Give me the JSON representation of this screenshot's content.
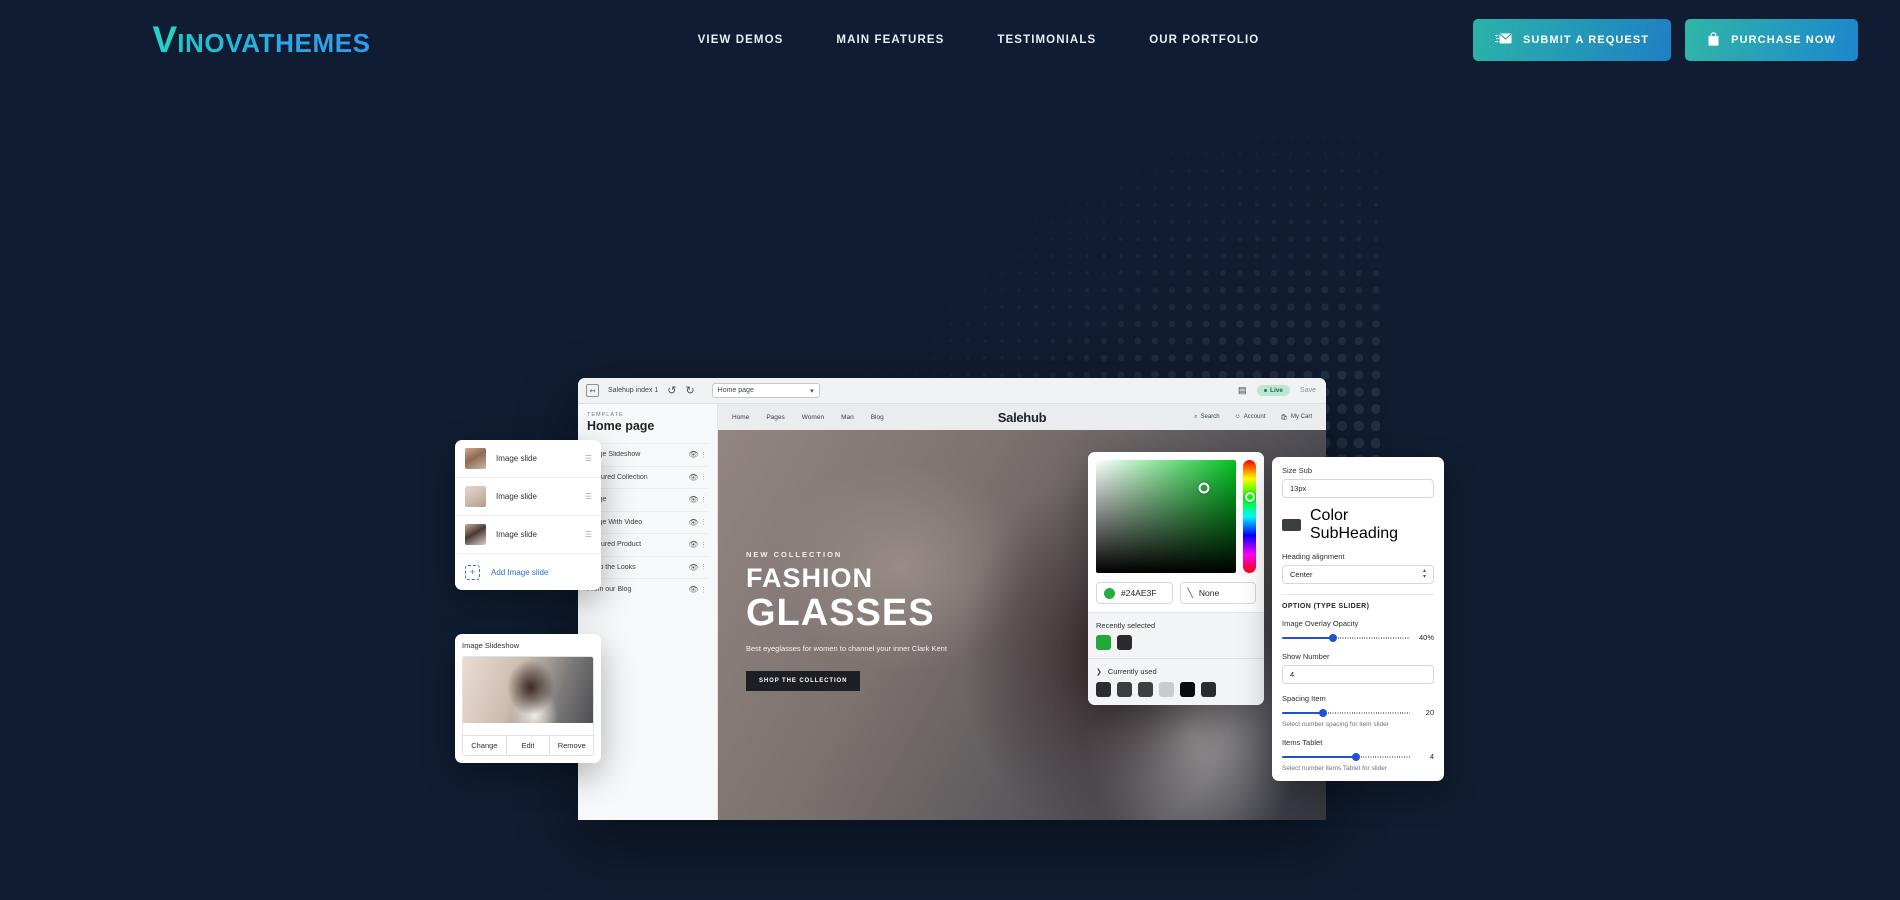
{
  "theme": {
    "page_bg": "#101c31",
    "accent_teal": "#22d3c5",
    "accent_blue": "#2f9bf0",
    "picker_green": "#24AE3F",
    "slider_blue": "#1f52d1"
  },
  "topnav": {
    "logo": {
      "first_letter": "V",
      "rest": "INOVATHEMES"
    },
    "links": [
      {
        "label": "VIEW DEMOS",
        "name": "nav-view-demos"
      },
      {
        "label": "MAIN FEATURES",
        "name": "nav-main-features"
      },
      {
        "label": "TESTIMONIALS",
        "name": "nav-testimonials"
      },
      {
        "label": "OUR PORTFOLIO",
        "name": "nav-our-portfolio"
      }
    ],
    "buttons": {
      "submit": {
        "label": "SUBMIT A REQUEST",
        "icon": "envelope-icon"
      },
      "purchase": {
        "label": "PURCHASE NOW",
        "icon": "shopping-bag-icon"
      }
    }
  },
  "editor": {
    "toolbar": {
      "exit_icon": "exit-icon",
      "title": "Salehup index 1",
      "undo_icon": "undo-icon",
      "redo_icon": "redo-icon",
      "page_select": "Home page",
      "device_icon": "desktop-icon",
      "live_badge": "Live",
      "save_label": "Save"
    },
    "sidebar": {
      "template_label": "TEMPLATE",
      "template_name": "Home page",
      "layers": [
        {
          "label": "Image Slideshow"
        },
        {
          "label": "Featured Collection"
        },
        {
          "label": "Image"
        },
        {
          "label": "Image With Video"
        },
        {
          "label": "Featured Product"
        },
        {
          "label": "Shop the Looks"
        },
        {
          "label": "From our Blog"
        }
      ]
    },
    "store": {
      "logo": "Salehub",
      "nav": [
        "Home",
        "Pages",
        "Women",
        "Man",
        "Blog"
      ],
      "actions": [
        {
          "label": "Search",
          "icon": "search-icon"
        },
        {
          "label": "Account",
          "icon": "account-icon"
        },
        {
          "label": "My Cart",
          "icon": "cart-icon"
        }
      ]
    },
    "hero": {
      "kicker": "NEW COLLECTION",
      "heading_1": "FASHION",
      "heading_2": "GLASSES",
      "subtitle": "Best eyeglasses for women to channel your inner Clark Kent",
      "cta": "SHOP THE COLLECTION"
    }
  },
  "slide_panel": {
    "rows": [
      {
        "label": "Image slide",
        "thumb": "t1",
        "grip": "drag-handle-icon"
      },
      {
        "label": "Image slide",
        "thumb": "t2",
        "grip": "drag-handle-icon"
      },
      {
        "label": "Image slide",
        "thumb": "t3",
        "grip": "drag-handle-icon"
      }
    ],
    "add_label": "Add Image slide"
  },
  "preview_panel": {
    "title": "Image Slideshow",
    "actions": [
      "Change",
      "Edit",
      "Remove"
    ]
  },
  "color_panel": {
    "hex": "#24AE3F",
    "none_label": "None",
    "recently_selected_label": "Recently selected",
    "recently_selected": [
      "#23a739",
      "#2b2b2d"
    ],
    "currently_used_label": "Currently used",
    "currently_used": [
      "#2d2d2f",
      "#3c3d3f",
      "#3f4043",
      "#c9cacb",
      "#0b0b0c",
      "#2a2b2d"
    ]
  },
  "settings_panel": {
    "size_sub": {
      "label": "Size Sub",
      "value": "13px"
    },
    "color_subheading": {
      "label": "Color SubHeading",
      "swatch": "#3a3d42"
    },
    "heading_alignment": {
      "label": "Heading alignment",
      "value": "Center"
    },
    "section_title": "OPTION (TYPE SLIDER)",
    "sliders": [
      {
        "label": "Image Overlay Opacity",
        "value": "40%",
        "percent": 40,
        "help": ""
      },
      {
        "label": "Spacing Item",
        "value": "20",
        "percent": 32,
        "help": "Select number spacing for item slider"
      },
      {
        "label": "Items Tablet",
        "value": "4",
        "percent": 58,
        "help": "Select number items Tablet for slider"
      }
    ],
    "show_number": {
      "label": "Show Number",
      "value": "4"
    }
  }
}
